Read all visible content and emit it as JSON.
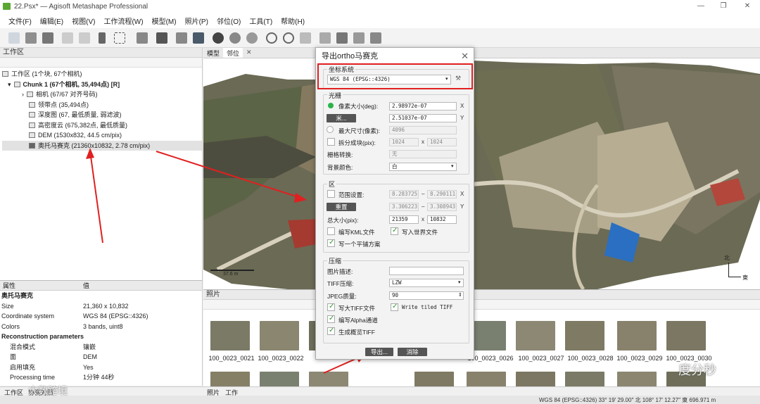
{
  "window": {
    "title": "22.Psx* — Agisoft Metashape Professional",
    "controls": [
      "—",
      "❐",
      "✕"
    ]
  },
  "menu": [
    "文件(F)",
    "编辑(E)",
    "视图(V)",
    "工作流程(W)",
    "模型(M)",
    "照片(P)",
    "邻位(O)",
    "工具(T)",
    "帮助(H)"
  ],
  "workspace": {
    "title": "工作区",
    "root": "工作区 (1个块, 67个相机)",
    "chunk": "Chunk 1 (67个相机, 35,494点) [R]",
    "items": [
      "相机 (67/67 对齐号码)",
      "领带点 (35,494点)",
      "深度图 (67, 最低质量, 弱滤波)",
      "高密度云 (675,382点, 最低质量)",
      "DEM (1530x832, 44.5 cm/pix)",
      "奥托马赛克 (21360x10832, 2.78 cm/pix)"
    ]
  },
  "properties": {
    "col_name": "属性",
    "col_value": "值",
    "title": "奥托马赛克",
    "rows": [
      [
        "Size",
        "21,360 x 10,832"
      ],
      [
        "Coordinate system",
        "WGS 84 (EPSG::4326)"
      ],
      [
        "Colors",
        "3 bands, uint8"
      ]
    ],
    "section": "Reconstruction parameters",
    "rows2": [
      [
        "混合模式",
        "镶嵌"
      ],
      [
        "面",
        "DEM"
      ],
      [
        "启用填充",
        "Yes"
      ],
      [
        "Processing time",
        "1分钟 44秒"
      ]
    ]
  },
  "view": {
    "tabs": [
      "模型",
      "邻位"
    ],
    "scale": "37.6 m",
    "north": "北",
    "east": "東"
  },
  "photos": {
    "title": "照片",
    "captions": [
      "100_0023_0021",
      "100_0023_0022",
      "100_0023_0026",
      "100_0023_0027",
      "100_0023_0028",
      "100_0023_0029",
      "100_0023_0030"
    ]
  },
  "bottom_tabs": [
    "工作区",
    "协调对照",
    "照片",
    "工作"
  ],
  "status": {
    "text": "WGS 84 (EPSG::4326)   33° 19′ 29.00″ 北   108° 17′ 12.27″ 東   696.971 m"
  },
  "dialog": {
    "title": "导出ortho马赛克",
    "close": "✕",
    "crs_group": "坐标系统",
    "crs_value": "WGS 84 (EPSG::4326)",
    "raster_group": "光栅",
    "pixel_size_label": "像素大小(deg):",
    "pixel_x": "2.98972e-07",
    "pixel_y": "2.51037e-07",
    "meters_btn": "米...",
    "max_dim_label": "最大尺寸(像素):",
    "max_dim": "4096",
    "split_label": "拆分成块(pix):",
    "split_x": "1024",
    "split_y": "1024",
    "raster_transform_label": "栅格转换:",
    "raster_transform": "无",
    "bg_label": "背景颜色:",
    "bg": "白",
    "region_group": "区",
    "range_label": "范围设置:",
    "r1": "8.283725",
    "r2": "8.290111",
    "r3": "3.306223",
    "r4": "3.308943",
    "reset_btn": "重置",
    "total_label": "总大小(pix):",
    "total_x": "21359",
    "total_y": "10832",
    "kml_label": "编写KML文件",
    "world_label": "写入世界文件",
    "tile_label": "写一个平铺方案",
    "comp_group": "压缩",
    "desc_label": "图片描述:",
    "desc": "",
    "tiff_comp_label": "TIFF压缩:",
    "tiff_comp": "LZW",
    "jpeg_label": "JPEG质量:",
    "jpeg": "90",
    "bigtiff_label": "写大TIFF文件",
    "tiled_label": "Write tiled TIFF",
    "alpha_label": "编写Alpha通道",
    "overview_label": "生成概览TIFF",
    "export_btn": "导出...",
    "cancel_btn": "消除",
    "axis_x": "X",
    "axis_y": "Y",
    "by": "x",
    "minus": "–"
  },
  "watermark": {
    "left": "大数跨境",
    "right": "度分秒"
  }
}
